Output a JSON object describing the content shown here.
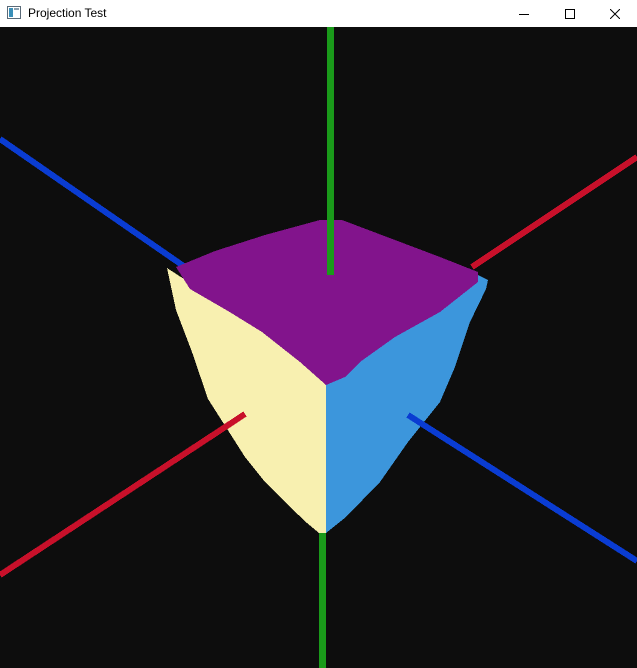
{
  "window": {
    "title": "Projection Test"
  },
  "titlebar": {
    "app_icon": "window-app-icon",
    "controls": [
      "minimize-icon",
      "maximize-icon",
      "close-icon"
    ]
  },
  "scene": {
    "background": "#0d0d0d",
    "cube_faces": {
      "top": "#82148c",
      "left": "#f8f0b0",
      "right": "#3c96dc"
    },
    "axis_colors": {
      "vertical": "#1a9a1a",
      "diagonal_a": "#c8102a",
      "diagonal_b": "#0a3cd2"
    }
  }
}
